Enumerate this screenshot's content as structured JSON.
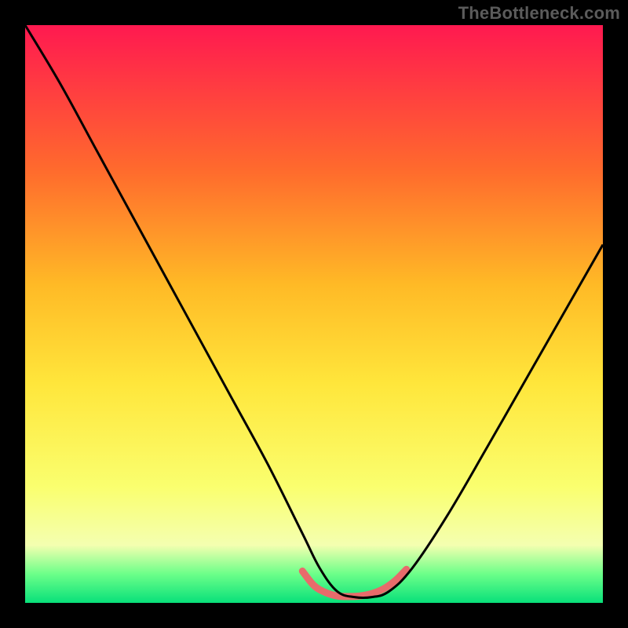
{
  "watermark": "TheBottleneck.com",
  "colors": {
    "bg": "#000000",
    "grad_top": "#ff1950",
    "grad_mid1": "#ff6a2d",
    "grad_mid2": "#ffba26",
    "grad_mid3": "#ffe63b",
    "grad_mid4": "#faff6f",
    "grad_bottom_y": "#f4ffb0",
    "grad_green1": "#6cff89",
    "grad_green2": "#08e07a",
    "curve": "#000000",
    "accent": "#e86b6b"
  },
  "chart_data": {
    "type": "line",
    "title": "",
    "xlabel": "",
    "ylabel": "",
    "xlim": [
      0,
      100
    ],
    "ylim": [
      0,
      100
    ],
    "series": [
      {
        "name": "main-curve",
        "x": [
          0,
          6,
          12,
          18,
          24,
          30,
          36,
          42,
          48,
          51,
          54,
          57,
          60,
          63,
          67,
          73,
          80,
          88,
          96,
          100
        ],
        "y": [
          100,
          90,
          79,
          68,
          57,
          46,
          35,
          24,
          12,
          6,
          2,
          1,
          1,
          2,
          6,
          15,
          27,
          41,
          55,
          62
        ]
      },
      {
        "name": "trough-accent",
        "x": [
          48,
          50,
          52,
          54,
          56,
          58,
          60,
          62,
          64,
          66
        ],
        "y": [
          5.5,
          3.0,
          1.8,
          1.2,
          1.1,
          1.2,
          1.6,
          2.4,
          3.8,
          5.8
        ]
      }
    ]
  }
}
